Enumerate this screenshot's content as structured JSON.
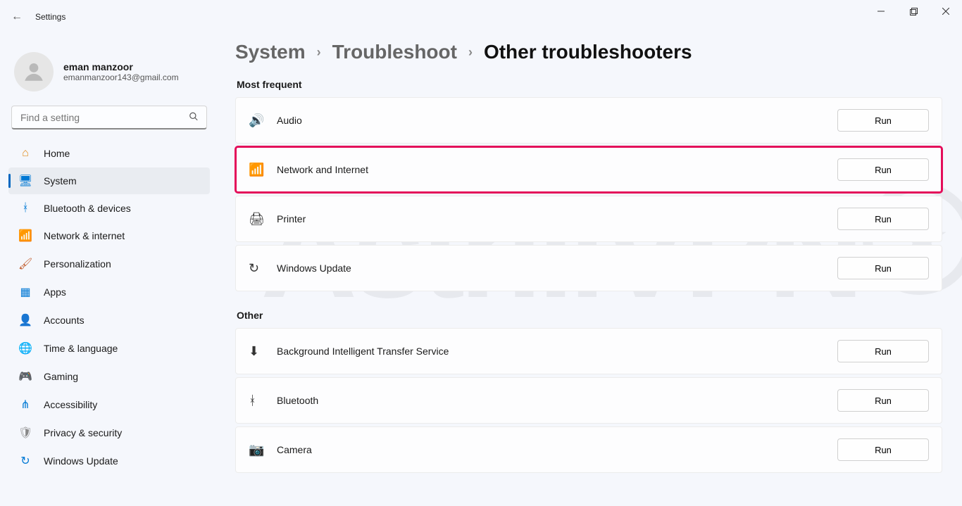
{
  "titlebar": {
    "app": "Settings"
  },
  "account": {
    "name": "eman manzoor",
    "email": "emanmanzoor143@gmail.com"
  },
  "search": {
    "placeholder": "Find a setting"
  },
  "nav": [
    {
      "label": "Home",
      "icon": "⌂",
      "cls": "ic-home"
    },
    {
      "label": "System",
      "icon": "🖥",
      "cls": "ic-sys",
      "active": true
    },
    {
      "label": "Bluetooth & devices",
      "icon": "ᚼ",
      "cls": "ic-bt"
    },
    {
      "label": "Network & internet",
      "icon": "📶",
      "cls": "ic-net"
    },
    {
      "label": "Personalization",
      "icon": "🖌",
      "cls": "ic-pers"
    },
    {
      "label": "Apps",
      "icon": "▦",
      "cls": "ic-apps"
    },
    {
      "label": "Accounts",
      "icon": "👤",
      "cls": "ic-acct"
    },
    {
      "label": "Time & language",
      "icon": "🌐",
      "cls": "ic-time"
    },
    {
      "label": "Gaming",
      "icon": "🎮",
      "cls": "ic-game"
    },
    {
      "label": "Accessibility",
      "icon": "⋔",
      "cls": "ic-acc"
    },
    {
      "label": "Privacy & security",
      "icon": "🛡",
      "cls": "ic-priv"
    },
    {
      "label": "Windows Update",
      "icon": "↻",
      "cls": "ic-upd"
    }
  ],
  "breadcrumb": {
    "a": "System",
    "b": "Troubleshoot",
    "c": "Other troubleshooters"
  },
  "sections": {
    "most_frequent": {
      "title": "Most frequent",
      "items": [
        {
          "label": "Audio",
          "icon": "🔊",
          "run": "Run"
        },
        {
          "label": "Network and Internet",
          "icon": "📶",
          "run": "Run",
          "highlight": true
        },
        {
          "label": "Printer",
          "icon": "🖨",
          "run": "Run"
        },
        {
          "label": "Windows Update",
          "icon": "↻",
          "run": "Run"
        }
      ]
    },
    "other": {
      "title": "Other",
      "items": [
        {
          "label": "Background Intelligent Transfer Service",
          "icon": "⬇",
          "run": "Run"
        },
        {
          "label": "Bluetooth",
          "icon": "ᚼ",
          "run": "Run"
        },
        {
          "label": "Camera",
          "icon": "📷",
          "run": "Run"
        }
      ]
    }
  },
  "watermark": "AstrillVPN"
}
